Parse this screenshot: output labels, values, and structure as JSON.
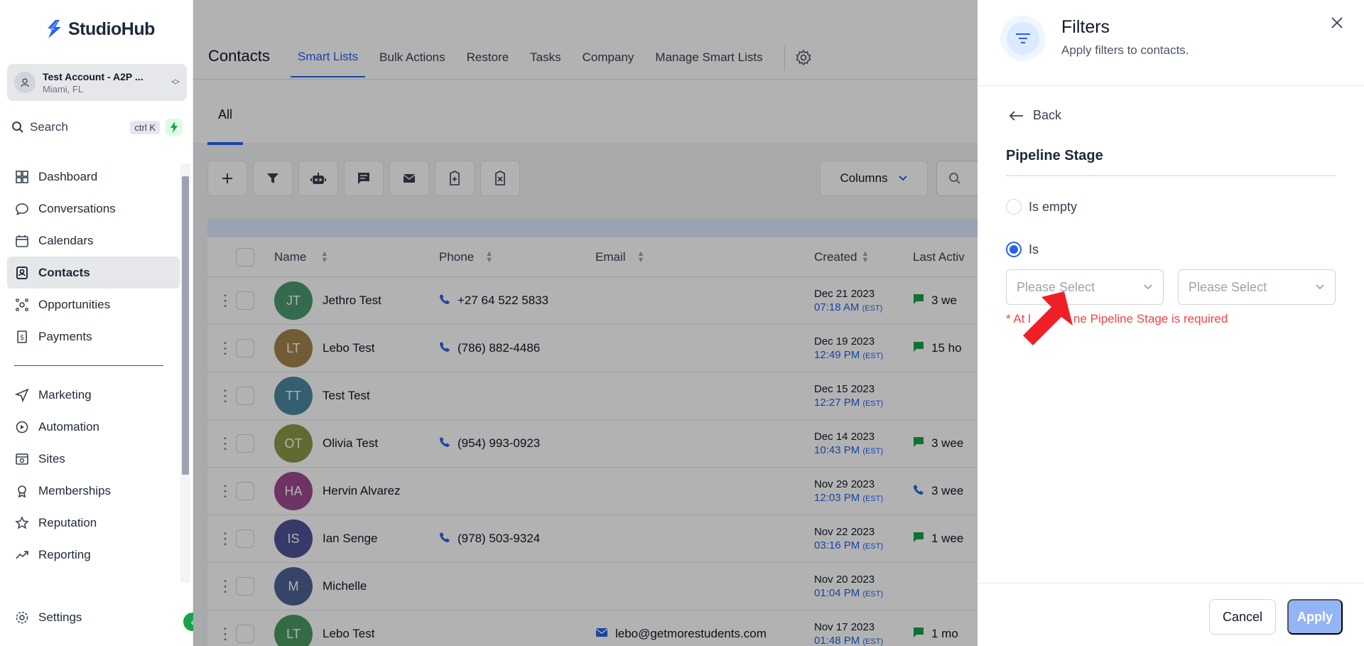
{
  "brand": {
    "name": "StudioHub",
    "accent": "#2563eb"
  },
  "account": {
    "name": "Test Account - A2P ...",
    "location": "Miami, FL"
  },
  "sidebar_search": {
    "label": "Search",
    "shortcut": "ctrl K"
  },
  "nav": {
    "items": [
      {
        "label": "Dashboard",
        "icon": "dashboard-icon"
      },
      {
        "label": "Conversations",
        "icon": "chat-bubble-icon"
      },
      {
        "label": "Calendars",
        "icon": "calendar-icon"
      },
      {
        "label": "Contacts",
        "icon": "contacts-icon",
        "active": true
      },
      {
        "label": "Opportunities",
        "icon": "opportunities-icon"
      },
      {
        "label": "Payments",
        "icon": "payments-icon"
      }
    ],
    "items2": [
      {
        "label": "Marketing",
        "icon": "send-icon"
      },
      {
        "label": "Automation",
        "icon": "automation-icon"
      },
      {
        "label": "Sites",
        "icon": "sites-icon"
      },
      {
        "label": "Memberships",
        "icon": "memberships-icon"
      },
      {
        "label": "Reputation",
        "icon": "star-icon"
      },
      {
        "label": "Reporting",
        "icon": "reporting-icon"
      }
    ],
    "settings": "Settings"
  },
  "topnav": {
    "title": "Contacts",
    "tabs": [
      "Smart Lists",
      "Bulk Actions",
      "Restore",
      "Tasks",
      "Company",
      "Manage Smart Lists"
    ]
  },
  "subtab": "All",
  "columns_label": "Columns",
  "table": {
    "headers": {
      "name": "Name",
      "phone": "Phone",
      "email": "Email",
      "created": "Created",
      "last": "Last Activ"
    },
    "rows": [
      {
        "initials": "JT",
        "color": "#4b9a70",
        "name": "Jethro Test",
        "phone": "+27 64 522 5833",
        "email": "",
        "date": "Dec 21 2023",
        "time": "07:18 AM",
        "tz": "(EST)",
        "last": "3 we",
        "last_icon": "message"
      },
      {
        "initials": "LT",
        "color": "#a3844d",
        "name": "Lebo Test",
        "phone": "(786) 882-4486",
        "email": "",
        "date": "Dec 19 2023",
        "time": "12:49 PM",
        "tz": "(EST)",
        "last": "15 ho",
        "last_icon": "message"
      },
      {
        "initials": "TT",
        "color": "#4d879e",
        "name": "Test Test",
        "phone": "",
        "email": "",
        "date": "Dec 15 2023",
        "time": "12:27 PM",
        "tz": "(EST)",
        "last": "",
        "last_icon": ""
      },
      {
        "initials": "OT",
        "color": "#8a9a48",
        "name": "Olivia Test",
        "phone": "(954) 993-0923",
        "email": "",
        "date": "Dec 14 2023",
        "time": "10:43 PM",
        "tz": "(EST)",
        "last": "3 wee",
        "last_icon": "message"
      },
      {
        "initials": "HA",
        "color": "#9c4a8f",
        "name": "Hervin Alvarez",
        "phone": "",
        "email": "",
        "date": "Nov 29 2023",
        "time": "12:03 PM",
        "tz": "(EST)",
        "last": "3 wee",
        "last_icon": "phone"
      },
      {
        "initials": "IS",
        "color": "#4f5296",
        "name": "Ian Senge",
        "phone": "(978) 503-9324",
        "email": "",
        "date": "Nov 22 2023",
        "time": "03:16 PM",
        "tz": "(EST)",
        "last": "1 wee",
        "last_icon": "message"
      },
      {
        "initials": "M",
        "color": "#4e6394",
        "name": "Michelle",
        "phone": "",
        "email": "",
        "date": "Nov 20 2023",
        "time": "01:04 PM",
        "tz": "(EST)",
        "last": "",
        "last_icon": ""
      },
      {
        "initials": "LT",
        "color": "#4b9a64",
        "name": "Lebo Test",
        "phone": "",
        "email": "lebo@getmorestudents.com",
        "date": "Nov 17 2023",
        "time": "01:48 PM",
        "tz": "(EST)",
        "last": "1 mo",
        "last_icon": "message"
      }
    ]
  },
  "panel": {
    "title": "Filters",
    "subtitle": "Apply filters to contacts.",
    "back": "Back",
    "section": "Pipeline Stage",
    "radio_empty": "Is empty",
    "radio_is": "Is",
    "select1_placeholder": "Please Select",
    "select2_placeholder": "Please Select",
    "error_prefix": "* At l",
    "error_suffix": "ne Pipeline Stage is required",
    "cancel": "Cancel",
    "apply": "Apply"
  }
}
